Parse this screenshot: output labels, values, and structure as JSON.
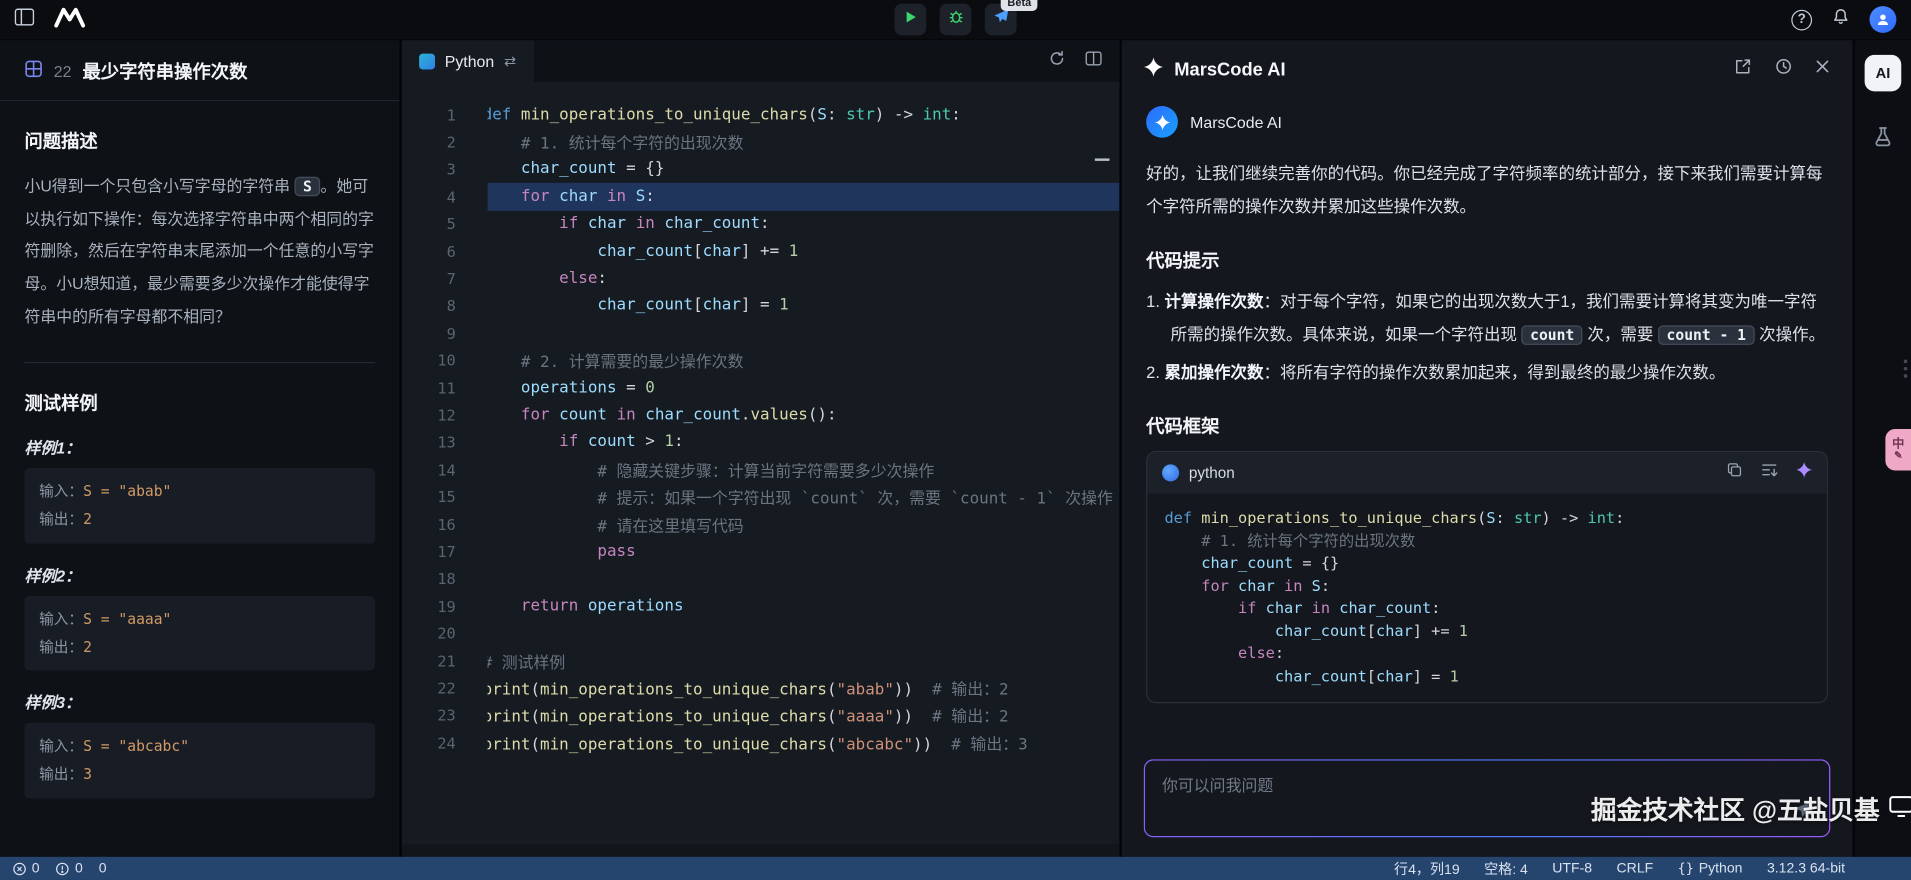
{
  "icons": {
    "help": "?",
    "swap": "⇄",
    "ai_badge": "AI",
    "translate": "中",
    "translate_sub": "✎",
    "braces": "{}"
  },
  "topbar": {
    "beta_badge": "Beta"
  },
  "problem": {
    "id": "22",
    "title": "最少字符串操作次数",
    "desc_heading": "问题描述",
    "desc_segments": [
      {
        "t": "小U得到一个只包含小写字母的字符串 "
      },
      {
        "c": "S"
      },
      {
        "t": "。她可以执行如下操作：每次选择字符串中两个相同的字符删除，然后在字符串末尾添加一个任意的小写字母。小U想知道，最少需要多少次操作才能使得字符串中的所有字母都不相同？"
      }
    ],
    "examples_heading": "测试样例",
    "examples": [
      {
        "label": "样例1：",
        "input_label": "输入：",
        "input_value": "S = \"abab\"",
        "output_label": "输出：",
        "output_value": "2"
      },
      {
        "label": "样例2：",
        "input_label": "输入：",
        "input_value": "S = \"aaaa\"",
        "output_label": "输出：",
        "output_value": "2"
      },
      {
        "label": "样例3：",
        "input_label": "输入：",
        "input_value": "S = \"abcabc\"",
        "output_label": "输出：",
        "output_value": "3"
      }
    ]
  },
  "editor": {
    "tab_label": "Python",
    "lines": [
      {
        "t": [
          [
            "def",
            "def "
          ],
          [
            "fn",
            "min_operations_to_unique_chars"
          ],
          [
            "pl",
            "("
          ],
          [
            "va",
            "S"
          ],
          [
            "pl",
            ": "
          ],
          [
            "ty",
            "str"
          ],
          [
            "pl",
            ") -> "
          ],
          [
            "ty",
            "int"
          ],
          [
            "pl",
            ":"
          ]
        ]
      },
      {
        "t": [
          [
            "cm",
            "    # 1. 统计每个字符的出现次数"
          ]
        ]
      },
      {
        "t": [
          [
            "pl",
            "    "
          ],
          [
            "va",
            "char_count"
          ],
          [
            "pl",
            " = {}"
          ]
        ]
      },
      {
        "hl": true,
        "t": [
          [
            "pl",
            "    "
          ],
          [
            "kw",
            "for"
          ],
          [
            "pl",
            " "
          ],
          [
            "va",
            "char"
          ],
          [
            "pl",
            " "
          ],
          [
            "kw",
            "in"
          ],
          [
            "pl",
            " "
          ],
          [
            "va",
            "S"
          ],
          [
            "pl",
            ":"
          ]
        ]
      },
      {
        "t": [
          [
            "pl",
            "        "
          ],
          [
            "kw",
            "if"
          ],
          [
            "pl",
            " "
          ],
          [
            "va",
            "char"
          ],
          [
            "pl",
            " "
          ],
          [
            "kw",
            "in"
          ],
          [
            "pl",
            " "
          ],
          [
            "va",
            "char_count"
          ],
          [
            "pl",
            ":"
          ]
        ]
      },
      {
        "t": [
          [
            "pl",
            "            "
          ],
          [
            "va",
            "char_count"
          ],
          [
            "pl",
            "["
          ],
          [
            "va",
            "char"
          ],
          [
            "pl",
            "] += "
          ],
          [
            "nu",
            "1"
          ]
        ]
      },
      {
        "t": [
          [
            "pl",
            "        "
          ],
          [
            "kw",
            "else"
          ],
          [
            "pl",
            ":"
          ]
        ]
      },
      {
        "t": [
          [
            "pl",
            "            "
          ],
          [
            "va",
            "char_count"
          ],
          [
            "pl",
            "["
          ],
          [
            "va",
            "char"
          ],
          [
            "pl",
            "] = "
          ],
          [
            "nu",
            "1"
          ]
        ]
      },
      {
        "t": []
      },
      {
        "t": [
          [
            "cm",
            "    # 2. 计算需要的最少操作次数"
          ]
        ]
      },
      {
        "t": [
          [
            "pl",
            "    "
          ],
          [
            "va",
            "operations"
          ],
          [
            "pl",
            " = "
          ],
          [
            "nu",
            "0"
          ]
        ]
      },
      {
        "t": [
          [
            "pl",
            "    "
          ],
          [
            "kw",
            "for"
          ],
          [
            "pl",
            " "
          ],
          [
            "va",
            "count"
          ],
          [
            "pl",
            " "
          ],
          [
            "kw",
            "in"
          ],
          [
            "pl",
            " "
          ],
          [
            "va",
            "char_count"
          ],
          [
            "pl",
            "."
          ],
          [
            "fn",
            "values"
          ],
          [
            "pl",
            "():"
          ]
        ]
      },
      {
        "t": [
          [
            "pl",
            "        "
          ],
          [
            "kw",
            "if"
          ],
          [
            "pl",
            " "
          ],
          [
            "va",
            "count"
          ],
          [
            "pl",
            " > "
          ],
          [
            "nu",
            "1"
          ],
          [
            "pl",
            ":"
          ]
        ]
      },
      {
        "t": [
          [
            "cm",
            "            # 隐藏关键步骤：计算当前字符需要多少次操作"
          ]
        ]
      },
      {
        "t": [
          [
            "cm",
            "            # 提示：如果一个字符出现 `count` 次，需要 `count - 1` 次操作"
          ]
        ]
      },
      {
        "t": [
          [
            "cm",
            "            # 请在这里填写代码"
          ]
        ]
      },
      {
        "t": [
          [
            "pl",
            "            "
          ],
          [
            "kw",
            "pass"
          ]
        ]
      },
      {
        "t": []
      },
      {
        "t": [
          [
            "pl",
            "    "
          ],
          [
            "kw",
            "return"
          ],
          [
            "pl",
            " "
          ],
          [
            "va",
            "operations"
          ]
        ]
      },
      {
        "t": []
      },
      {
        "t": [
          [
            "cm",
            "# 测试样例"
          ]
        ]
      },
      {
        "t": [
          [
            "fn",
            "print"
          ],
          [
            "pl",
            "("
          ],
          [
            "fn",
            "min_operations_to_unique_chars"
          ],
          [
            "pl",
            "("
          ],
          [
            "st",
            "\"abab\""
          ],
          [
            "pl",
            "))  "
          ],
          [
            "cm",
            "# 输出：2"
          ]
        ]
      },
      {
        "t": [
          [
            "fn",
            "print"
          ],
          [
            "pl",
            "("
          ],
          [
            "fn",
            "min_operations_to_unique_chars"
          ],
          [
            "pl",
            "("
          ],
          [
            "st",
            "\"aaaa\""
          ],
          [
            "pl",
            "))  "
          ],
          [
            "cm",
            "# 输出：2"
          ]
        ]
      },
      {
        "t": [
          [
            "fn",
            "print"
          ],
          [
            "pl",
            "("
          ],
          [
            "fn",
            "min_operations_to_unique_chars"
          ],
          [
            "pl",
            "("
          ],
          [
            "st",
            "\"abcabc\""
          ],
          [
            "pl",
            "))  "
          ],
          [
            "cm",
            "# 输出：3"
          ]
        ]
      }
    ]
  },
  "ai": {
    "panel_title": "MarsCode AI",
    "assistant_name": "MarsCode AI",
    "message": "好的，让我们继续完善你的代码。你已经完成了字符频率的统计部分，接下来我们需要计算每个字符所需的操作次数并累加这些操作次数。",
    "hints_heading": "代码提示",
    "hints": [
      {
        "num": "1.",
        "segments": [
          {
            "b": "计算操作次数"
          },
          {
            "t": "：对于每个字符，如果它的出现次数大于1，我们需要计算将其变为唯一字符所需的操作次数。具体来说，如果一个字符出现 "
          },
          {
            "c": "count"
          },
          {
            "t": " 次，需要 "
          },
          {
            "c": "count - 1"
          },
          {
            "t": " 次操作。"
          }
        ]
      },
      {
        "num": "2.",
        "segments": [
          {
            "b": "累加操作次数"
          },
          {
            "t": "：将所有字符的操作次数累加起来，得到最终的最少操作次数。"
          }
        ]
      }
    ],
    "framework_heading": "代码框架",
    "code_lang": "python",
    "code_lines": [
      {
        "t": [
          [
            "def",
            "def "
          ],
          [
            "fn",
            "min_operations_to_unique_chars"
          ],
          [
            "pl",
            "("
          ],
          [
            "va",
            "S"
          ],
          [
            "pl",
            ": "
          ],
          [
            "ty",
            "str"
          ],
          [
            "pl",
            ") -> "
          ],
          [
            "ty",
            "int"
          ],
          [
            "pl",
            ":"
          ]
        ]
      },
      {
        "t": [
          [
            "cm",
            "    # 1. 统计每个字符的出现次数"
          ]
        ]
      },
      {
        "t": [
          [
            "pl",
            "    "
          ],
          [
            "va",
            "char_count"
          ],
          [
            "pl",
            " = {}"
          ]
        ]
      },
      {
        "t": [
          [
            "pl",
            "    "
          ],
          [
            "kw",
            "for"
          ],
          [
            "pl",
            " "
          ],
          [
            "va",
            "char"
          ],
          [
            "pl",
            " "
          ],
          [
            "kw",
            "in"
          ],
          [
            "pl",
            " "
          ],
          [
            "va",
            "S"
          ],
          [
            "pl",
            ":"
          ]
        ]
      },
      {
        "t": [
          [
            "pl",
            "        "
          ],
          [
            "kw",
            "if"
          ],
          [
            "pl",
            " "
          ],
          [
            "va",
            "char"
          ],
          [
            "pl",
            " "
          ],
          [
            "kw",
            "in"
          ],
          [
            "pl",
            " "
          ],
          [
            "va",
            "char_count"
          ],
          [
            "pl",
            ":"
          ]
        ]
      },
      {
        "t": [
          [
            "pl",
            "            "
          ],
          [
            "va",
            "char_count"
          ],
          [
            "pl",
            "["
          ],
          [
            "va",
            "char"
          ],
          [
            "pl",
            "] += "
          ],
          [
            "nu",
            "1"
          ]
        ]
      },
      {
        "t": [
          [
            "pl",
            "        "
          ],
          [
            "kw",
            "else"
          ],
          [
            "pl",
            ":"
          ]
        ]
      },
      {
        "t": [
          [
            "pl",
            "            "
          ],
          [
            "va",
            "char_count"
          ],
          [
            "pl",
            "["
          ],
          [
            "va",
            "char"
          ],
          [
            "pl",
            "] = "
          ],
          [
            "nu",
            "1"
          ]
        ]
      }
    ],
    "input_placeholder": "你可以问我问题"
  },
  "statusbar": {
    "errors": "0",
    "warnings": "0",
    "infos": "0",
    "cursor": "行4，列19",
    "indent": "空格: 4",
    "encoding": "UTF-8",
    "eol": "CRLF",
    "language": "Python",
    "runtime": "3.12.3 64-bit"
  },
  "watermark": "掘金技术社区 @五盐贝基"
}
